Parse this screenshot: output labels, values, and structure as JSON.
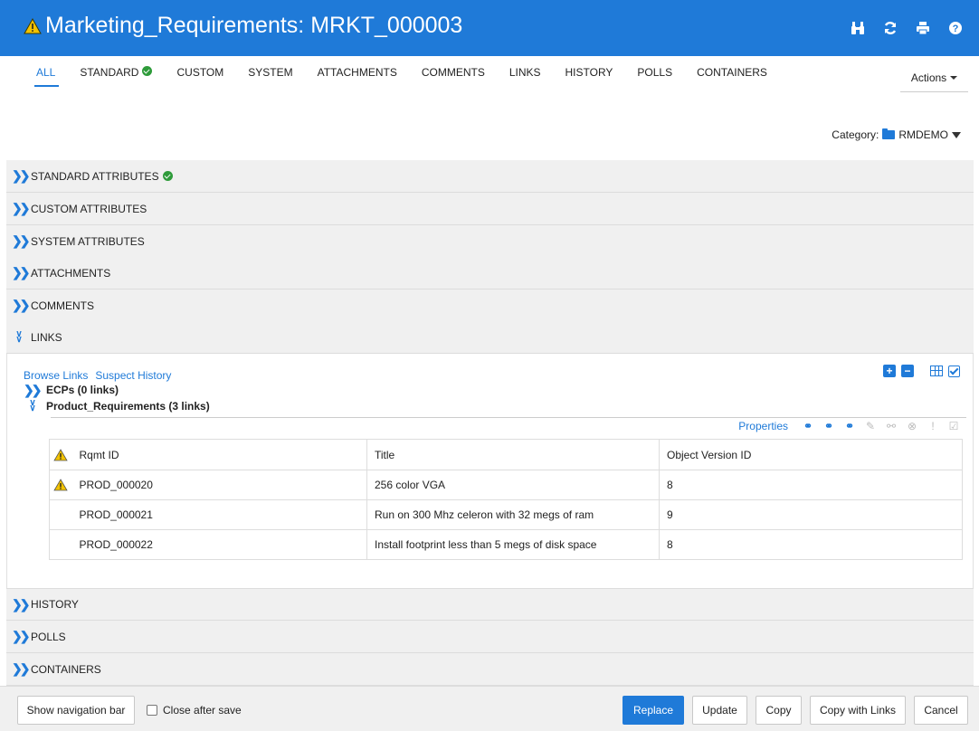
{
  "header": {
    "title": "Marketing_Requirements: MRKT_000003",
    "icons": [
      "binoculars-icon",
      "refresh-icon",
      "print-icon",
      "help-icon"
    ]
  },
  "tabs": [
    {
      "label": "ALL",
      "active": true
    },
    {
      "label": "STANDARD",
      "check": true
    },
    {
      "label": "CUSTOM"
    },
    {
      "label": "SYSTEM"
    },
    {
      "label": "ATTACHMENTS"
    },
    {
      "label": "COMMENTS"
    },
    {
      "label": "LINKS"
    },
    {
      "label": "HISTORY"
    },
    {
      "label": "POLLS"
    },
    {
      "label": "CONTAINERS"
    }
  ],
  "actions_label": "Actions",
  "category": {
    "label": "Category:",
    "value": "RMDEMO"
  },
  "sections": {
    "standard": "STANDARD ATTRIBUTES",
    "custom": "CUSTOM ATTRIBUTES",
    "system": "SYSTEM ATTRIBUTES",
    "attachments": "ATTACHMENTS",
    "comments": "COMMENTS",
    "links": "LINKS",
    "history": "HISTORY",
    "polls": "POLLS",
    "containers": "CONTAINERS"
  },
  "links_panel": {
    "browse_links": "Browse Links",
    "suspect_history": "Suspect History",
    "groups": [
      {
        "label": "ECPs (0 links)",
        "expanded": false
      },
      {
        "label": "Product_Requirements (3 links)",
        "expanded": true
      }
    ],
    "properties_label": "Properties",
    "columns": [
      "Rqmt ID",
      "Title",
      "Object Version ID"
    ],
    "rows": [
      {
        "warning": true,
        "id": "PROD_000020",
        "title": "256 color VGA",
        "version": "8"
      },
      {
        "warning": false,
        "id": "PROD_000021",
        "title": "Run on 300 Mhz celeron with 32 megs of ram",
        "version": "9"
      },
      {
        "warning": false,
        "id": "PROD_000022",
        "title": "Install footprint less than 5 megs of disk space",
        "version": "8"
      }
    ]
  },
  "footer": {
    "show_nav": "Show navigation bar",
    "close_after_save": "Close after save",
    "replace": "Replace",
    "update": "Update",
    "copy": "Copy",
    "copy_with_links": "Copy with Links",
    "cancel": "Cancel"
  },
  "colors": {
    "accent": "#1f7ad8",
    "success": "#2e9b3a",
    "warning": "#f2c200"
  }
}
